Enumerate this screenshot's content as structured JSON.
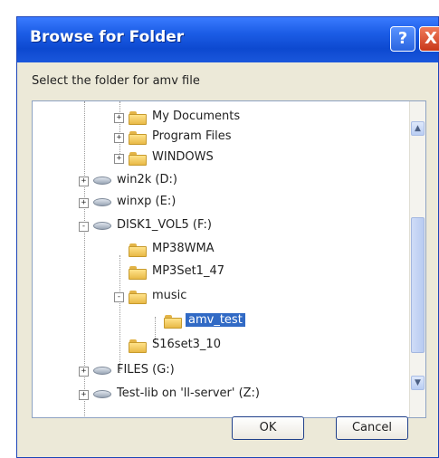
{
  "window": {
    "title": "Browse for Folder"
  },
  "titlebar": {
    "help_glyph": "?",
    "close_glyph": "X"
  },
  "prompt": "Select the folder for amv file",
  "tree": {
    "items": [
      {
        "label": "My Documents",
        "icon": "folder-icon",
        "expander": "+"
      },
      {
        "label": "Program Files",
        "icon": "folder-icon",
        "expander": "+"
      },
      {
        "label": "WINDOWS",
        "icon": "folder-icon",
        "expander": "+"
      },
      {
        "label": "win2k (D:)",
        "icon": "drive-icon",
        "expander": "+"
      },
      {
        "label": "winxp (E:)",
        "icon": "drive-icon",
        "expander": "+"
      },
      {
        "label": "DISK1_VOL5 (F:)",
        "icon": "drive-icon",
        "expander": "-"
      },
      {
        "label": "MP38WMA",
        "icon": "folder-icon",
        "expander": ""
      },
      {
        "label": "MP3Set1_47",
        "icon": "folder-icon",
        "expander": ""
      },
      {
        "label": "music",
        "icon": "folder-icon",
        "expander": "-"
      },
      {
        "label": "amv_test",
        "icon": "folder-icon",
        "expander": "",
        "selected": true
      },
      {
        "label": "S16set3_10",
        "icon": "folder-icon",
        "expander": ""
      },
      {
        "label": "FILES (G:)",
        "icon": "drive-icon",
        "expander": "+"
      },
      {
        "label": "Test-lib on 'll-server' (Z:)",
        "icon": "drive-icon",
        "expander": "+"
      }
    ]
  },
  "scroll": {
    "up_glyph": "▲",
    "down_glyph": "▼"
  },
  "buttons": {
    "ok": "OK",
    "cancel": "Cancel"
  }
}
